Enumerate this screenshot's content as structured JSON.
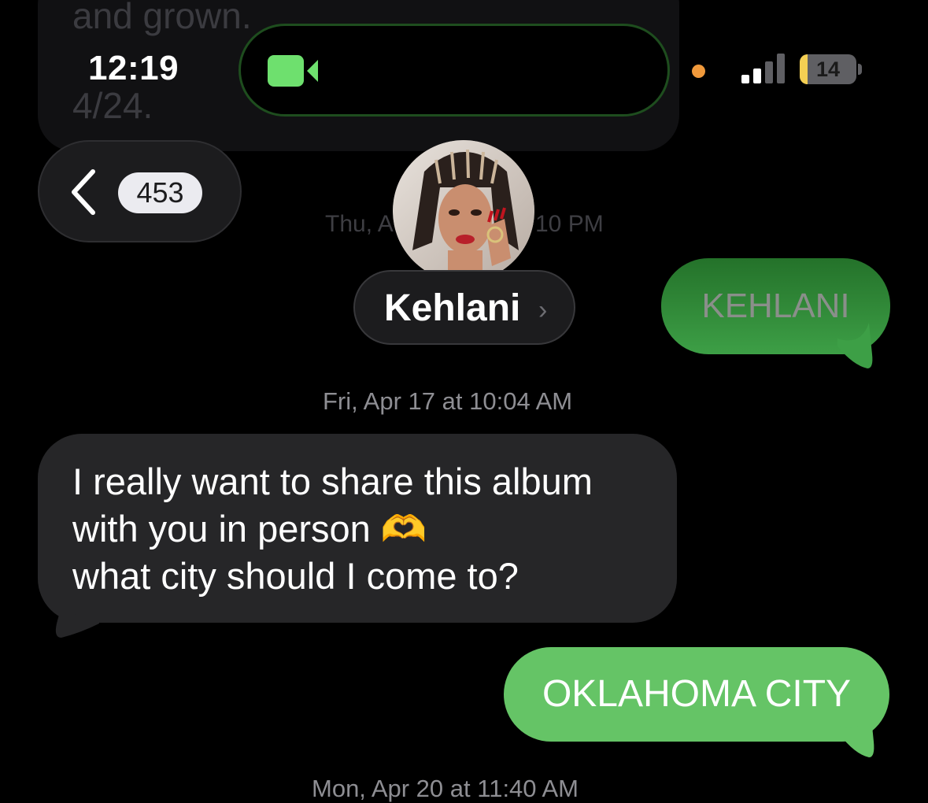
{
  "background_bubble": {
    "line1": "and grown.",
    "line2": "4/24."
  },
  "status_bar": {
    "time": "12:19",
    "battery": "14",
    "battery_level_pct": 14,
    "call_icon": "facetime-video-icon",
    "colors": {
      "call_green": "#6ee06e",
      "battery_yellow": "#f4cf53",
      "orange_dot": "#f0993b"
    }
  },
  "nav": {
    "back_icon": "chevron-left-icon",
    "unread_count": "453"
  },
  "contact": {
    "name": "Kehlani",
    "chevron": "›",
    "faded_timestamp_left": "Thu, A",
    "faded_timestamp_right": "10 PM"
  },
  "messages": [
    {
      "type": "sent",
      "text": "KEHLANI",
      "faded": true,
      "color": "#3d9f46"
    },
    {
      "type": "timestamp",
      "day": "Fri, Apr 17",
      "at": "at",
      "time": "10:04 AM"
    },
    {
      "type": "received",
      "lines": [
        "I really want to share this album",
        "with you in person 🫶",
        "what city should I come to?"
      ],
      "color": "#262628"
    },
    {
      "type": "sent",
      "text": "OKLAHOMA CITY",
      "color": "#65c466"
    },
    {
      "type": "timestamp",
      "day": "Mon, Apr 20",
      "at": "at",
      "time": "11:40 AM"
    }
  ]
}
